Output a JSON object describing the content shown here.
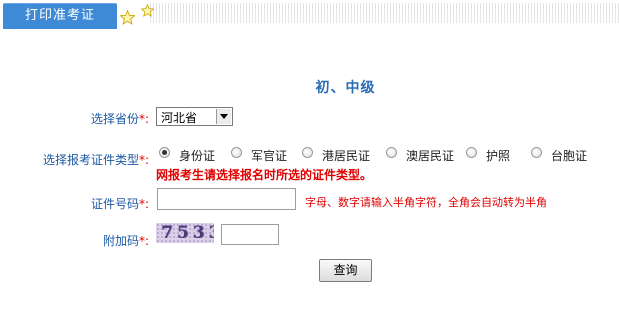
{
  "header": {
    "tab_label": "打印准考证",
    "icons": [
      "star-icon",
      "star-icon"
    ]
  },
  "section": {
    "title": "初、中级"
  },
  "form": {
    "province": {
      "label": "选择省份",
      "required_mark": "*:",
      "selected": "河北省"
    },
    "id_type": {
      "label": "选择报考证件类型",
      "required_mark": "*:",
      "options": [
        "身份证",
        "军官证",
        "港居民证",
        "澳居民证",
        "护照",
        "台胞证"
      ],
      "selected_index": 0,
      "warning": "网报考生请选择报名时所选的证件类型。"
    },
    "id_number": {
      "label": "证件号码",
      "required_mark": "*:",
      "value": "",
      "hint": "字母、数字请输入半角字符，全角会自动转为半角"
    },
    "captcha": {
      "label": "附加码",
      "required_mark": "*:",
      "code": "7533",
      "value": ""
    },
    "submit_label": "查询"
  },
  "colors": {
    "tab_bg": "#3f8ad6",
    "label_blue": "#1d5aa5",
    "title_blue": "#2a6db5",
    "warning_red": "#e00000"
  }
}
